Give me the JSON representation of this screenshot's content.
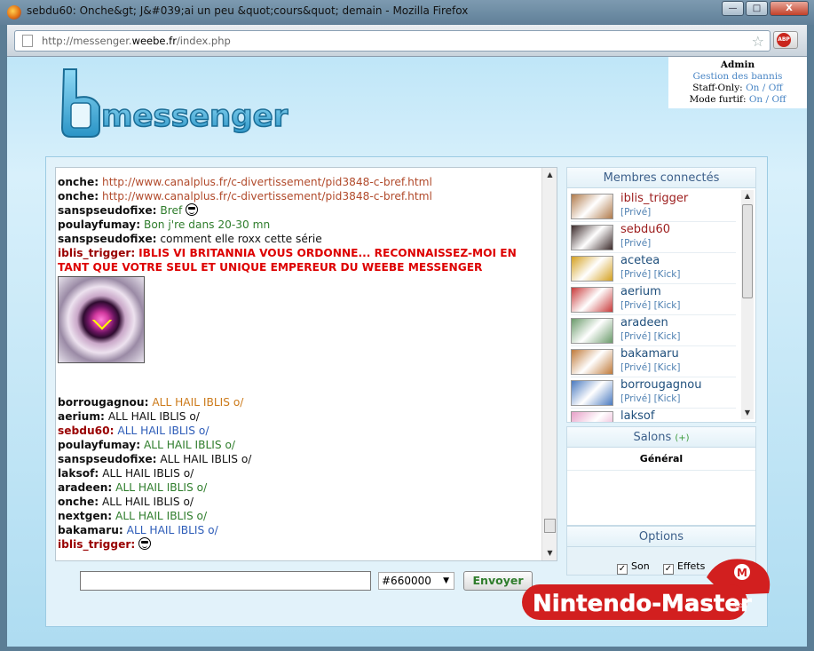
{
  "window": {
    "title": "sebdu60: Onche&gt; J&#039;ai un peu &quot;cours&quot; demain - Mozilla Firefox",
    "minimize": "—",
    "maximize": "□",
    "close": "X"
  },
  "browser": {
    "url_prefix": "http://messenger.",
    "url_domain": "weebe.fr",
    "url_suffix": "/index.php",
    "abp_label": "ABP"
  },
  "brand": {
    "logo_text": "messenger"
  },
  "admin": {
    "heading": "Admin",
    "banned_link": "Gestion des bannis",
    "staff_only_label": "Staff-Only:",
    "on": "On",
    "sep": "/",
    "off": "Off",
    "stealth_label": "Mode furtif:"
  },
  "chat": {
    "lines": [
      {
        "user": "onche:",
        "text": "http://www.canalplus.fr/c-divertissement/pid3848-c-bref.html",
        "cls": "c-link"
      },
      {
        "user": "onche:",
        "text": "http://www.canalplus.fr/c-divertissement/pid3848-c-bref.html",
        "cls": "c-link"
      },
      {
        "user": "sanspseudofixe:",
        "text": "Bref",
        "cls": "c-green",
        "smiley": true
      },
      {
        "user": "poulayfumay:",
        "text": "Bon j're dans 20-30 mn",
        "cls": "c-green"
      },
      {
        "user": "sanspseudofixe:",
        "text": "comment elle roxx cette série",
        "cls": "c-blk"
      }
    ],
    "shout_user": "iblis_trigger:",
    "shout_text": "IBLIS VI BRITANNIA VOUS ORDONNE... RECONNAISSEZ-MOI EN TANT QUE VOTRE SEUL ET UNIQUE EMPEREUR DU WEEBE MESSENGER",
    "lines2": [
      {
        "user": "borrougagnou:",
        "text": "ALL HAIL IBLIS o/",
        "cls": "c-orange"
      },
      {
        "user": "aerium:",
        "text": "ALL HAIL IBLIS o/",
        "cls": "c-blk"
      },
      {
        "user": "sebdu60:",
        "text": "ALL HAIL IBLIS o/",
        "cls": "c-blue",
        "red": true
      },
      {
        "user": "poulayfumay:",
        "text": "ALL HAIL IBLIS o/",
        "cls": "c-green"
      },
      {
        "user": "sanspseudofixe:",
        "text": "ALL HAIL IBLIS o/",
        "cls": "c-blk"
      },
      {
        "user": "laksof:",
        "text": "ALL HAIL IBLIS o/",
        "cls": "c-blk"
      },
      {
        "user": "aradeen:",
        "text": "ALL HAIL IBLIS o/",
        "cls": "c-green"
      },
      {
        "user": "onche:",
        "text": "ALL HAIL IBLIS o/",
        "cls": "c-blk"
      },
      {
        "user": "nextgen:",
        "text": "ALL HAIL IBLIS o/",
        "cls": "c-green"
      },
      {
        "user": "bakamaru:",
        "text": "ALL HAIL IBLIS o/",
        "cls": "c-blue"
      },
      {
        "user": "iblis_trigger:",
        "text": "",
        "cls": "c-blk",
        "red": true,
        "smiley": true
      }
    ]
  },
  "composer": {
    "message_value": "",
    "color_value": "#660000",
    "send_label": "Envoyer"
  },
  "members": {
    "heading": "Membres connectés",
    "list": [
      {
        "name": "iblis_trigger",
        "links": "[Privé]",
        "red": true,
        "av": "#b07a4a"
      },
      {
        "name": "sebdu60",
        "links": "[Privé]",
        "red": true,
        "av": "#3b2a2a"
      },
      {
        "name": "acetea",
        "links": "[Privé] [Kick]",
        "av": "#d4a020"
      },
      {
        "name": "aerium",
        "links": "[Privé] [Kick]",
        "av": "#c83a3a"
      },
      {
        "name": "aradeen",
        "links": "[Privé] [Kick]",
        "av": "#6a9a6a"
      },
      {
        "name": "bakamaru",
        "links": "[Privé] [Kick]",
        "av": "#c07a3a"
      },
      {
        "name": "borrougagnou",
        "links": "[Privé] [Kick]",
        "av": "#4a7ac0"
      },
      {
        "name": "laksof",
        "links": "",
        "av": "#e7a0c8"
      }
    ]
  },
  "salons": {
    "heading": "Salons",
    "add": "(+)",
    "items": [
      "Général"
    ]
  },
  "options": {
    "heading": "Options",
    "sound_label": "Son",
    "effects_label": "Effets",
    "check_mark": "✓"
  },
  "watermark": {
    "text": "Nintendo-Master",
    "tld": ".COM"
  }
}
